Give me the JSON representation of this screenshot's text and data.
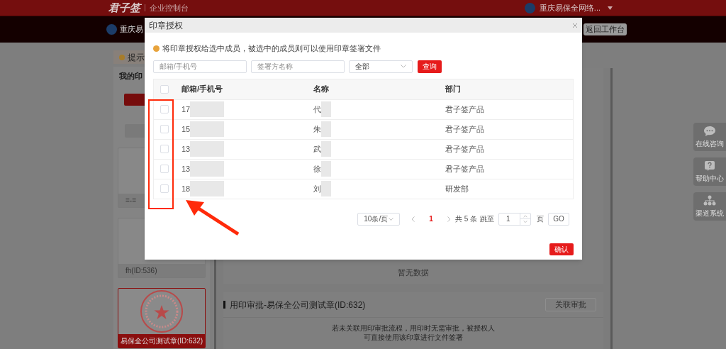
{
  "header": {
    "logo": "君子签",
    "title": "企业控制台",
    "account": "重庆易保全网络..."
  },
  "subbar": {
    "org": "重庆易",
    "back_button": "返回工作台"
  },
  "notice": "提示",
  "sidebar": {
    "title": "我的印",
    "seals": [
      {
        "label": "=-=",
        "selected": false
      },
      {
        "label": "fh(ID:536)",
        "selected": false
      },
      {
        "label": "易保全公司测试章(ID:632)",
        "selected": true
      }
    ]
  },
  "main": {
    "empty_text": "暂无数据",
    "approval": {
      "title": "用印审批-易保全公司测试章(ID:632)",
      "button": "关联审批",
      "note": [
        "若未关联用印审批流程，用印时无需审批，被授权人",
        "可直接使用该印章进行文件签署"
      ]
    }
  },
  "float_buttons": [
    {
      "kind": "chat",
      "label": "在线咨询"
    },
    {
      "kind": "help",
      "label": "帮助中心"
    },
    {
      "kind": "channels",
      "label": "渠道系统"
    }
  ],
  "dialog": {
    "title": "印章授权",
    "info": "将印章授权给选中成员，被选中的成员则可以使用印章签署文件",
    "filters": {
      "email_placeholder": "邮箱/手机号",
      "name_placeholder": "签署方名称",
      "department": "全部",
      "search_button": "查询"
    },
    "columns": [
      "邮箱/手机号",
      "名称",
      "部门"
    ],
    "header_checked": false,
    "rows": [
      {
        "checked": false,
        "email": "17",
        "name": "代",
        "department": "君子签产品"
      },
      {
        "checked": false,
        "email": "15",
        "name": "朱",
        "department": "君子签产品"
      },
      {
        "checked": false,
        "email": "13",
        "name": "武",
        "department": "君子签产品"
      },
      {
        "checked": false,
        "email": "13",
        "name": "徐",
        "department": "君子签产品"
      },
      {
        "checked": false,
        "email": "18",
        "name": "刘",
        "department": "研发部"
      }
    ],
    "pagination": {
      "page_size": "10条/页",
      "pages": [
        {
          "label": "1",
          "selected": true
        }
      ],
      "total": "共 5 条",
      "jump_label": "跳至",
      "jump_value": "1",
      "page_unit": "页",
      "go_button": "GO"
    },
    "confirm_button": "确认"
  }
}
